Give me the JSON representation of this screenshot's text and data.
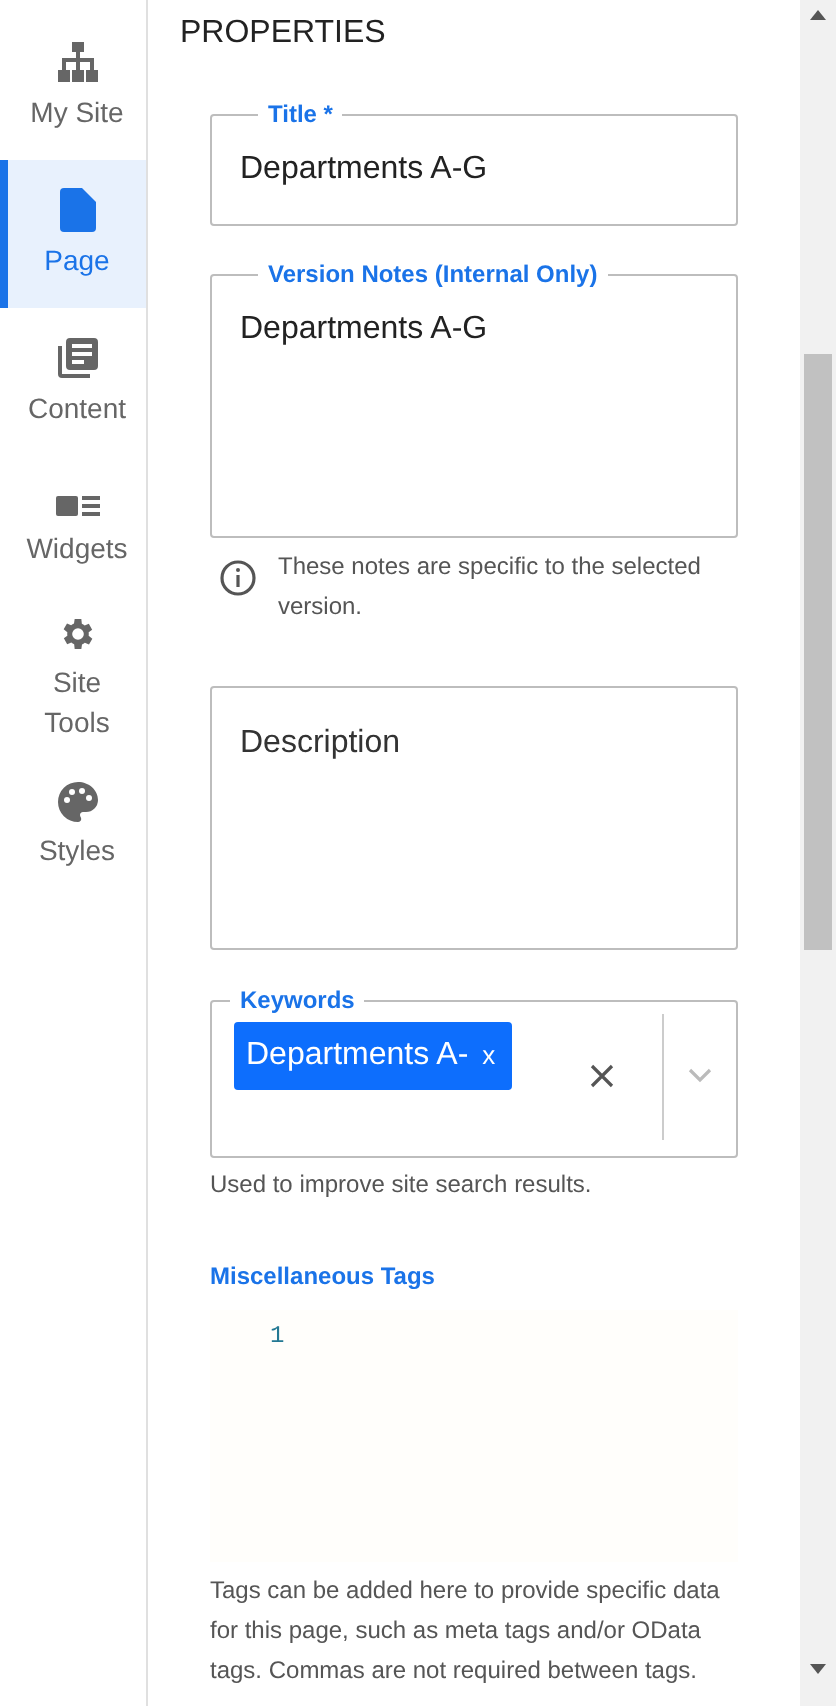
{
  "sidebar": {
    "items": [
      {
        "label": "My Site",
        "kind": "sitemap",
        "selected": false
      },
      {
        "label": "Page",
        "kind": "page",
        "selected": true
      },
      {
        "label": "Content",
        "kind": "content",
        "selected": false
      },
      {
        "label": "Widgets",
        "kind": "widgets",
        "selected": false
      },
      {
        "label": "Site Tools",
        "kind": "tools",
        "selected": false
      },
      {
        "label": "Styles",
        "kind": "styles",
        "selected": false
      }
    ]
  },
  "heading": "PROPERTIES",
  "title_field": {
    "label": "Title",
    "required_mark": "*",
    "value": "Departments A-G"
  },
  "version_notes": {
    "label": "Version Notes (Internal Only)",
    "value": "Departments A-G",
    "note": "These notes are specific to the selected version."
  },
  "description": {
    "placeholder": "Description"
  },
  "keywords": {
    "label": "Keywords",
    "chips": [
      {
        "label": "Departments A-",
        "remove": "x"
      }
    ],
    "help": "Used to improve site search results."
  },
  "misc_tags": {
    "label": "Miscellaneous Tags",
    "line_numbers": [
      "1"
    ],
    "help": "Tags can be added here to provide specific data for this page, such as meta tags and/or OData tags. Commas are not required between tags."
  }
}
